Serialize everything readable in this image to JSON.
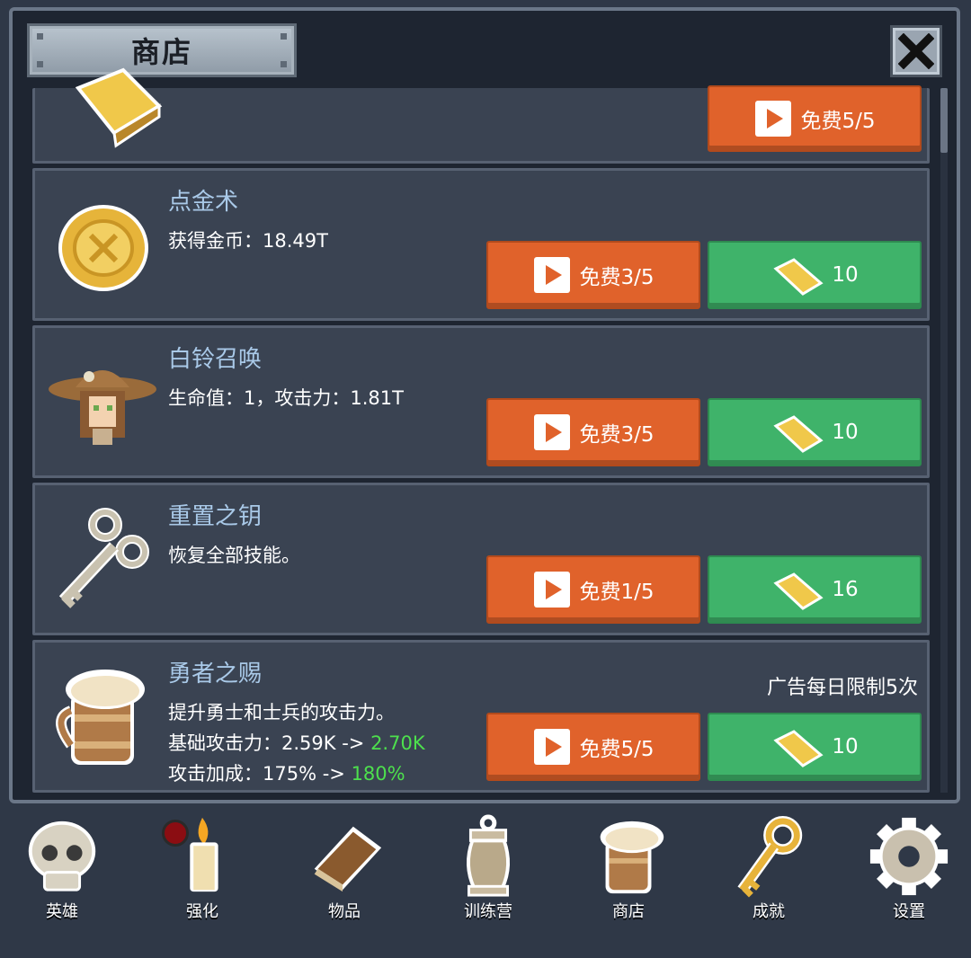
{
  "header": {
    "title": "商店"
  },
  "rows": [
    {
      "free_label": "免费5/5"
    },
    {
      "name": "点金术",
      "desc": "获得金币：18.49T",
      "free_label": "免费3/5",
      "price": "10"
    },
    {
      "name": "白铃召唤",
      "desc": "生命值：1，攻击力：1.81T",
      "free_label": "免费3/5",
      "price": "10"
    },
    {
      "name": "重置之钥",
      "desc": "恢复全部技能。",
      "free_label": "免费1/5",
      "price": "16"
    },
    {
      "name": "勇者之赐",
      "desc1": "提升勇士和士兵的攻击力。",
      "desc2_prefix": "基础攻击力：2.59K -> ",
      "desc2_new": "2.70K",
      "desc3_prefix": "攻击加成：175% -> ",
      "desc3_new": "180%",
      "limit": "广告每日限制5次",
      "free_label": "免费5/5",
      "price": "10"
    }
  ],
  "nav": [
    {
      "label": "英雄",
      "icon": "skull-icon"
    },
    {
      "label": "强化",
      "icon": "candle-icon"
    },
    {
      "label": "物品",
      "icon": "book-icon"
    },
    {
      "label": "训练营",
      "icon": "lantern-icon"
    },
    {
      "label": "商店",
      "icon": "beer-mug-icon"
    },
    {
      "label": "成就",
      "icon": "key-icon"
    },
    {
      "label": "设置",
      "icon": "gear-icon"
    }
  ],
  "colors": {
    "free_button": "#e0622b",
    "gold_button": "#3fb36a",
    "name_text": "#a9c9e8",
    "upgrade_text": "#4de04d"
  }
}
